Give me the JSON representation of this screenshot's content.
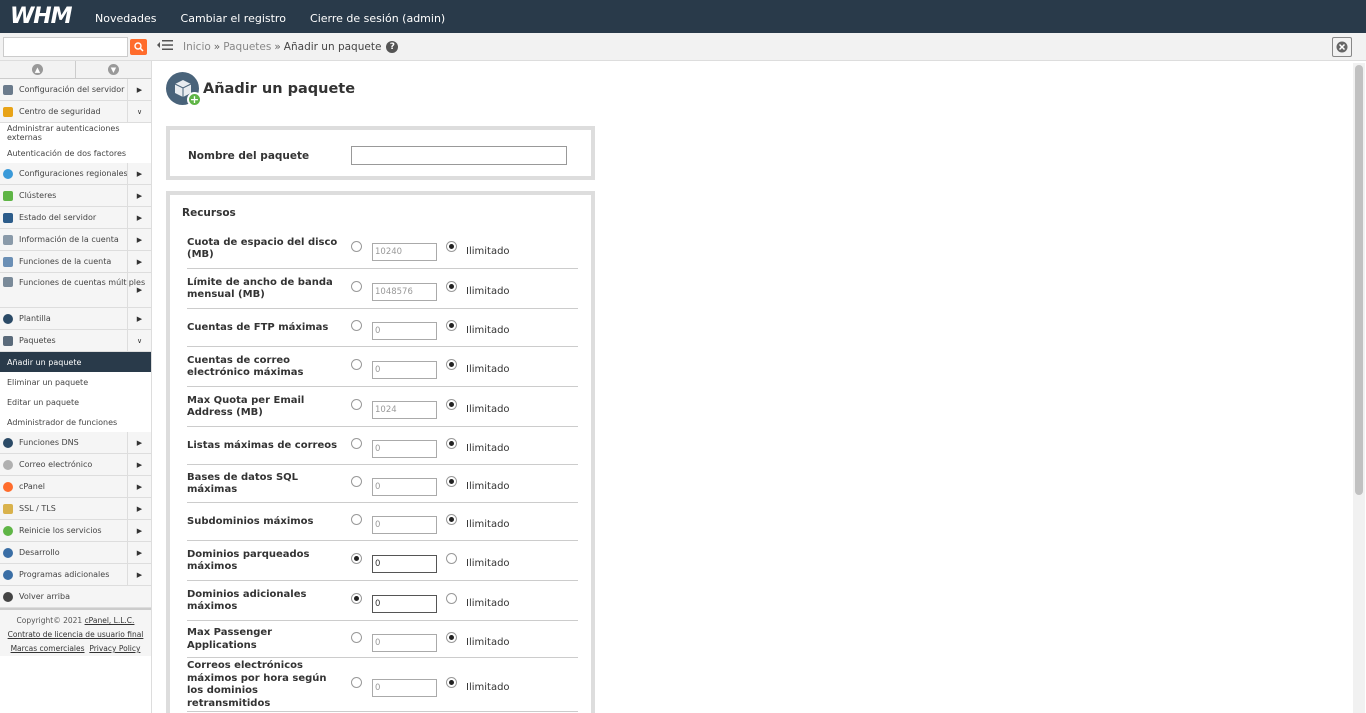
{
  "topbar": {
    "logo": "WHM",
    "links": [
      "Novedades",
      "Cambiar el registro",
      "Cierre de sesión (admin)"
    ]
  },
  "search": {
    "placeholder": ""
  },
  "breadcrumb": {
    "items": [
      "Inicio",
      "Paquetes"
    ],
    "current": "Añadir un paquete",
    "sep": "»"
  },
  "sidebar": {
    "items": [
      {
        "label": "Configuración del servidor",
        "icon": "server-config-icon",
        "color": "#6b7b8c",
        "expand": "▶"
      },
      {
        "label": "Centro de seguridad",
        "icon": "lock-icon",
        "color": "#e8a317",
        "expand": "∨"
      },
      {
        "label": "Administrar autenticaciones externas",
        "sub": true
      },
      {
        "label": "Autenticación de dos factores",
        "sub": true
      },
      {
        "label": "Configuraciones regionales",
        "icon": "globe-icon",
        "color": "#3a9ad9",
        "expand": "▶"
      },
      {
        "label": "Clústeres",
        "icon": "cluster-icon",
        "color": "#5fb546",
        "expand": "▶"
      },
      {
        "label": "Estado del servidor",
        "icon": "monitor-icon",
        "color": "#2c5c8a",
        "expand": "▶"
      },
      {
        "label": "Información de la cuenta",
        "icon": "account-info-icon",
        "color": "#8a9aa9",
        "expand": "▶"
      },
      {
        "label": "Funciones de la cuenta",
        "icon": "user-icon",
        "color": "#6b8fb5",
        "expand": "▶"
      },
      {
        "label": "Funciones de cuentas múltiples",
        "icon": "multi-account-icon",
        "color": "#7a8a99",
        "expand": "▶",
        "tall": true
      },
      {
        "label": "Plantilla",
        "icon": "theme-icon",
        "color": "#2b4a66",
        "expand": "▶"
      },
      {
        "label": "Paquetes",
        "icon": "package-icon",
        "color": "#5a6a7a",
        "expand": "∨"
      },
      {
        "label": "Añadir un paquete",
        "sub": true,
        "active": true
      },
      {
        "label": "Eliminar un paquete",
        "sub": true
      },
      {
        "label": "Editar un paquete",
        "sub": true
      },
      {
        "label": "Administrador de funciones",
        "sub": true
      },
      {
        "label": "Funciones DNS",
        "icon": "dns-icon",
        "color": "#2b4a66",
        "expand": "▶"
      },
      {
        "label": "Correo electrónico",
        "icon": "email-icon",
        "color": "#b0b0b0",
        "expand": "▶"
      },
      {
        "label": "cPanel",
        "icon": "cpanel-icon",
        "color": "#ff6c2c",
        "expand": "▶"
      },
      {
        "label": "SSL / TLS",
        "icon": "certificate-icon",
        "color": "#d9b24c",
        "expand": "▶"
      },
      {
        "label": "Reinicie los servicios",
        "icon": "restart-icon",
        "color": "#5fb546",
        "expand": "▶"
      },
      {
        "label": "Desarrollo",
        "icon": "development-icon",
        "color": "#3a6ea5",
        "expand": "▶"
      },
      {
        "label": "Programas adicionales",
        "icon": "plugins-icon",
        "color": "#3a6ea5",
        "expand": "▶"
      },
      {
        "label": "Volver arriba",
        "icon": "back-to-top-icon",
        "color": "#444"
      }
    ],
    "footer": {
      "copyright": "Copyright© 2021",
      "company": "cPanel, L.L.C.",
      "eula": "Contrato de licencia de usuario final",
      "trademarks": "Marcas comerciales",
      "privacy": "Privacy Policy"
    }
  },
  "page": {
    "title": "Añadir un paquete"
  },
  "package_name": {
    "label": "Nombre del paquete",
    "value": ""
  },
  "resources": {
    "title": "Recursos",
    "unlimited_label": "Ilimitado",
    "rows": [
      {
        "label": "Cuota de espacio del disco (MB)",
        "value": "10240",
        "unlimited": true
      },
      {
        "label": "Límite de ancho de banda mensual (MB)",
        "value": "1048576",
        "unlimited": true
      },
      {
        "label": "Cuentas de FTP máximas",
        "value": "0",
        "unlimited": true
      },
      {
        "label": "Cuentas de correo electrónico máximas",
        "value": "0",
        "unlimited": true
      },
      {
        "label": "Max Quota per Email Address (MB)",
        "value": "1024",
        "unlimited": true
      },
      {
        "label": "Listas máximas de correos",
        "value": "0",
        "unlimited": true
      },
      {
        "label": "Bases de datos SQL máximas",
        "value": "0",
        "unlimited": true
      },
      {
        "label": "Subdominios máximos",
        "value": "0",
        "unlimited": true
      },
      {
        "label": "Dominios parqueados máximos",
        "value": "0",
        "unlimited": false
      },
      {
        "label": "Dominios adicionales máximos",
        "value": "0",
        "unlimited": false
      },
      {
        "label": "Max Passenger Applications",
        "value": "0",
        "unlimited": true
      },
      {
        "label": "Correos electrónicos máximos por hora según los dominios retransmitidos",
        "value": "0",
        "unlimited": true
      }
    ]
  }
}
